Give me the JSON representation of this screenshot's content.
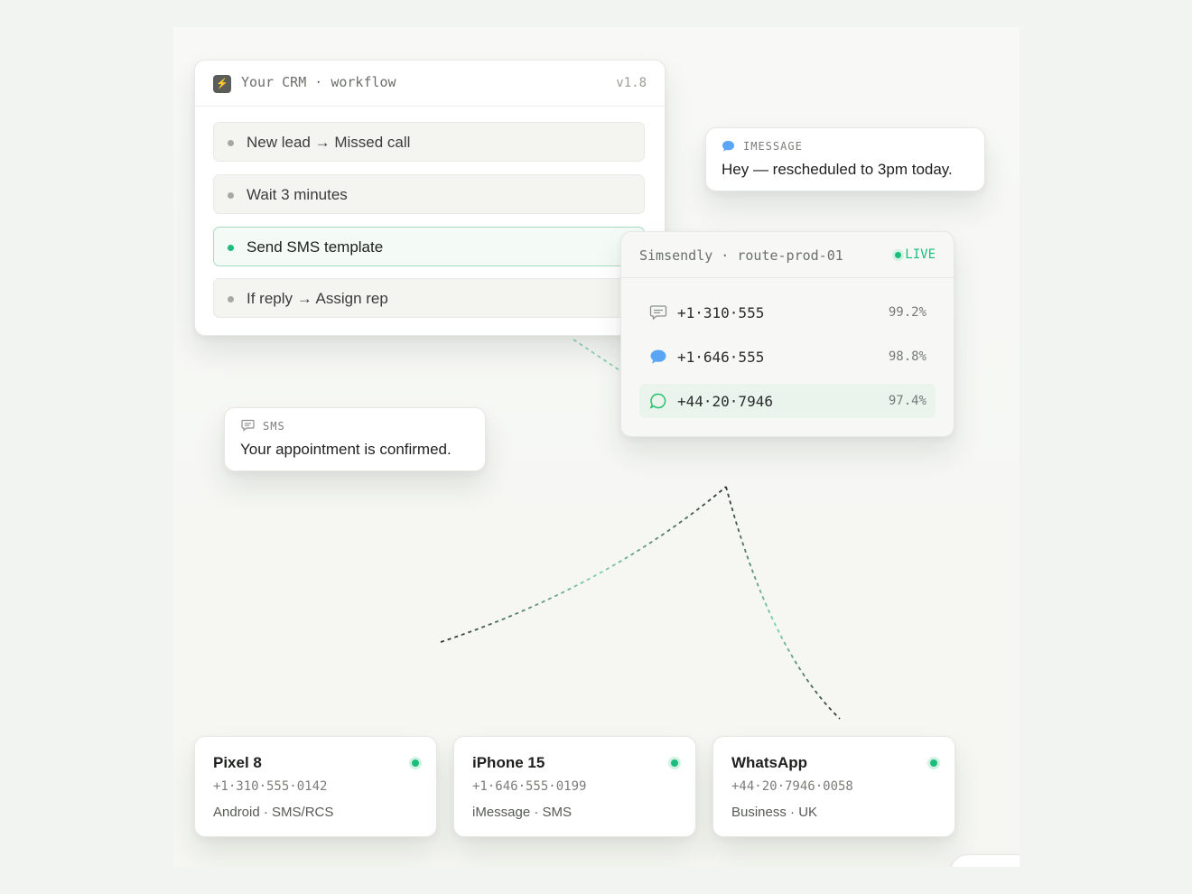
{
  "crm": {
    "badge": "⚡",
    "title": "Your CRM · workflow",
    "version": "v1.8",
    "steps": [
      {
        "label": "New lead → Missed call"
      },
      {
        "label": "Wait 3 minutes"
      },
      {
        "label": "Send SMS template"
      },
      {
        "label": "If reply → Assign rep"
      }
    ]
  },
  "imessage": {
    "tag": "IMESSAGE",
    "text": "Hey — rescheduled to 3pm today."
  },
  "sms": {
    "tag": "SMS",
    "text": "Your appointment is confirmed."
  },
  "route": {
    "title": "Simsendly · route-prod-01",
    "status": "LIVE",
    "rows": [
      {
        "icon": "sms-icon",
        "number": "+1·310·555",
        "rate": "99.2%"
      },
      {
        "icon": "imessage-icon",
        "number": "+1·646·555",
        "rate": "98.8%"
      },
      {
        "icon": "whatsapp-icon",
        "number": "+44·20·7946",
        "rate": "97.4%"
      }
    ]
  },
  "devices": [
    {
      "name": "Pixel 8",
      "phone": "+1·310·555·0142",
      "sub": "Android · SMS/RCS"
    },
    {
      "name": "iPhone 15",
      "phone": "+1·646·555·0199",
      "sub": "iMessage · SMS"
    },
    {
      "name": "WhatsApp",
      "phone": "+44·20·7946·0058",
      "sub": "Business · UK"
    }
  ],
  "colors": {
    "accent": "#1cbd7c",
    "imessage": "#5aa6f5",
    "background": "#f1f4f0"
  }
}
